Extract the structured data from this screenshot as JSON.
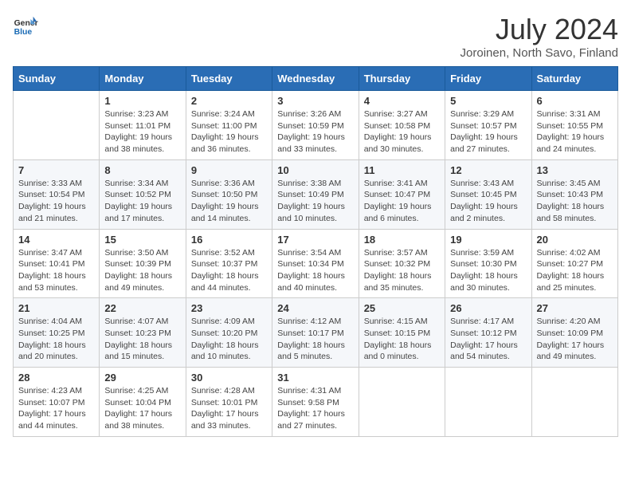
{
  "header": {
    "logo_line1": "General",
    "logo_line2": "Blue",
    "month_year": "July 2024",
    "location": "Joroinen, North Savo, Finland"
  },
  "weekdays": [
    "Sunday",
    "Monday",
    "Tuesday",
    "Wednesday",
    "Thursday",
    "Friday",
    "Saturday"
  ],
  "weeks": [
    [
      {
        "day": "",
        "sunrise": "",
        "sunset": "",
        "daylight": ""
      },
      {
        "day": "1",
        "sunrise": "Sunrise: 3:23 AM",
        "sunset": "Sunset: 11:01 PM",
        "daylight": "Daylight: 19 hours and 38 minutes."
      },
      {
        "day": "2",
        "sunrise": "Sunrise: 3:24 AM",
        "sunset": "Sunset: 11:00 PM",
        "daylight": "Daylight: 19 hours and 36 minutes."
      },
      {
        "day": "3",
        "sunrise": "Sunrise: 3:26 AM",
        "sunset": "Sunset: 10:59 PM",
        "daylight": "Daylight: 19 hours and 33 minutes."
      },
      {
        "day": "4",
        "sunrise": "Sunrise: 3:27 AM",
        "sunset": "Sunset: 10:58 PM",
        "daylight": "Daylight: 19 hours and 30 minutes."
      },
      {
        "day": "5",
        "sunrise": "Sunrise: 3:29 AM",
        "sunset": "Sunset: 10:57 PM",
        "daylight": "Daylight: 19 hours and 27 minutes."
      },
      {
        "day": "6",
        "sunrise": "Sunrise: 3:31 AM",
        "sunset": "Sunset: 10:55 PM",
        "daylight": "Daylight: 19 hours and 24 minutes."
      }
    ],
    [
      {
        "day": "7",
        "sunrise": "Sunrise: 3:33 AM",
        "sunset": "Sunset: 10:54 PM",
        "daylight": "Daylight: 19 hours and 21 minutes."
      },
      {
        "day": "8",
        "sunrise": "Sunrise: 3:34 AM",
        "sunset": "Sunset: 10:52 PM",
        "daylight": "Daylight: 19 hours and 17 minutes."
      },
      {
        "day": "9",
        "sunrise": "Sunrise: 3:36 AM",
        "sunset": "Sunset: 10:50 PM",
        "daylight": "Daylight: 19 hours and 14 minutes."
      },
      {
        "day": "10",
        "sunrise": "Sunrise: 3:38 AM",
        "sunset": "Sunset: 10:49 PM",
        "daylight": "Daylight: 19 hours and 10 minutes."
      },
      {
        "day": "11",
        "sunrise": "Sunrise: 3:41 AM",
        "sunset": "Sunset: 10:47 PM",
        "daylight": "Daylight: 19 hours and 6 minutes."
      },
      {
        "day": "12",
        "sunrise": "Sunrise: 3:43 AM",
        "sunset": "Sunset: 10:45 PM",
        "daylight": "Daylight: 19 hours and 2 minutes."
      },
      {
        "day": "13",
        "sunrise": "Sunrise: 3:45 AM",
        "sunset": "Sunset: 10:43 PM",
        "daylight": "Daylight: 18 hours and 58 minutes."
      }
    ],
    [
      {
        "day": "14",
        "sunrise": "Sunrise: 3:47 AM",
        "sunset": "Sunset: 10:41 PM",
        "daylight": "Daylight: 18 hours and 53 minutes."
      },
      {
        "day": "15",
        "sunrise": "Sunrise: 3:50 AM",
        "sunset": "Sunset: 10:39 PM",
        "daylight": "Daylight: 18 hours and 49 minutes."
      },
      {
        "day": "16",
        "sunrise": "Sunrise: 3:52 AM",
        "sunset": "Sunset: 10:37 PM",
        "daylight": "Daylight: 18 hours and 44 minutes."
      },
      {
        "day": "17",
        "sunrise": "Sunrise: 3:54 AM",
        "sunset": "Sunset: 10:34 PM",
        "daylight": "Daylight: 18 hours and 40 minutes."
      },
      {
        "day": "18",
        "sunrise": "Sunrise: 3:57 AM",
        "sunset": "Sunset: 10:32 PM",
        "daylight": "Daylight: 18 hours and 35 minutes."
      },
      {
        "day": "19",
        "sunrise": "Sunrise: 3:59 AM",
        "sunset": "Sunset: 10:30 PM",
        "daylight": "Daylight: 18 hours and 30 minutes."
      },
      {
        "day": "20",
        "sunrise": "Sunrise: 4:02 AM",
        "sunset": "Sunset: 10:27 PM",
        "daylight": "Daylight: 18 hours and 25 minutes."
      }
    ],
    [
      {
        "day": "21",
        "sunrise": "Sunrise: 4:04 AM",
        "sunset": "Sunset: 10:25 PM",
        "daylight": "Daylight: 18 hours and 20 minutes."
      },
      {
        "day": "22",
        "sunrise": "Sunrise: 4:07 AM",
        "sunset": "Sunset: 10:23 PM",
        "daylight": "Daylight: 18 hours and 15 minutes."
      },
      {
        "day": "23",
        "sunrise": "Sunrise: 4:09 AM",
        "sunset": "Sunset: 10:20 PM",
        "daylight": "Daylight: 18 hours and 10 minutes."
      },
      {
        "day": "24",
        "sunrise": "Sunrise: 4:12 AM",
        "sunset": "Sunset: 10:17 PM",
        "daylight": "Daylight: 18 hours and 5 minutes."
      },
      {
        "day": "25",
        "sunrise": "Sunrise: 4:15 AM",
        "sunset": "Sunset: 10:15 PM",
        "daylight": "Daylight: 18 hours and 0 minutes."
      },
      {
        "day": "26",
        "sunrise": "Sunrise: 4:17 AM",
        "sunset": "Sunset: 10:12 PM",
        "daylight": "Daylight: 17 hours and 54 minutes."
      },
      {
        "day": "27",
        "sunrise": "Sunrise: 4:20 AM",
        "sunset": "Sunset: 10:09 PM",
        "daylight": "Daylight: 17 hours and 49 minutes."
      }
    ],
    [
      {
        "day": "28",
        "sunrise": "Sunrise: 4:23 AM",
        "sunset": "Sunset: 10:07 PM",
        "daylight": "Daylight: 17 hours and 44 minutes."
      },
      {
        "day": "29",
        "sunrise": "Sunrise: 4:25 AM",
        "sunset": "Sunset: 10:04 PM",
        "daylight": "Daylight: 17 hours and 38 minutes."
      },
      {
        "day": "30",
        "sunrise": "Sunrise: 4:28 AM",
        "sunset": "Sunset: 10:01 PM",
        "daylight": "Daylight: 17 hours and 33 minutes."
      },
      {
        "day": "31",
        "sunrise": "Sunrise: 4:31 AM",
        "sunset": "Sunset: 9:58 PM",
        "daylight": "Daylight: 17 hours and 27 minutes."
      },
      {
        "day": "",
        "sunrise": "",
        "sunset": "",
        "daylight": ""
      },
      {
        "day": "",
        "sunrise": "",
        "sunset": "",
        "daylight": ""
      },
      {
        "day": "",
        "sunrise": "",
        "sunset": "",
        "daylight": ""
      }
    ]
  ]
}
